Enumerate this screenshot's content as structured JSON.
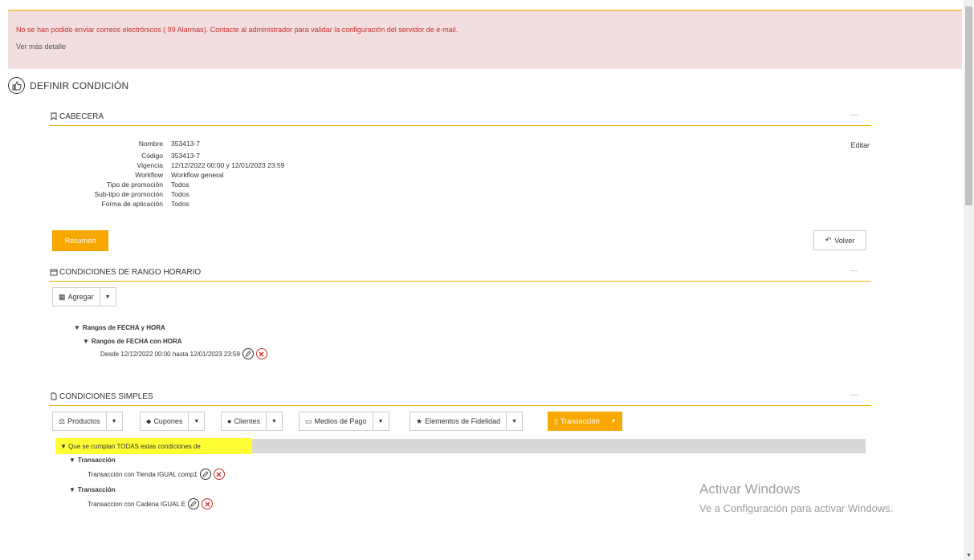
{
  "alert": {
    "message": "No se han podido enviar correos electrónicos ( 99 Alarmas). Contacte al administrador para validar la configuración del servidor de e-mail.",
    "link": "Ver más detalle"
  },
  "page": {
    "title": "DEFINIR CONDICIÓN",
    "title_icon": "thumbs-up-icon"
  },
  "cabecera": {
    "title": "CABECERA",
    "collapse": "—",
    "edit_label": "Editar",
    "fields": [
      {
        "label": "Nombre",
        "value": "353413-7"
      },
      {
        "label": "Código",
        "value": "353413-7"
      },
      {
        "label": "Vigencia",
        "value": "12/12/2022 00:00 y 12/01/2023 23:59"
      },
      {
        "label": "Workflow",
        "value": "Workflow general"
      },
      {
        "label": "Tipo de promoción",
        "value": "Todos"
      },
      {
        "label": "Sub-tipo de promoción",
        "value": "Todos"
      },
      {
        "label": "Forma de aplicación",
        "value": "Todos"
      }
    ],
    "resumen_label": "Resumen",
    "volver_label": "Volver"
  },
  "rango": {
    "title": "CONDICIONES DE RANGO HORARIO",
    "collapse": "—",
    "agregar_label": "Agregar",
    "tree_root": "Rangos de FECHA y HORA",
    "tree_child": "Rangos de FECHA con HORA",
    "tree_item": "Desde 12/12/2022 00:00 hasta 12/01/2023 23:59"
  },
  "simples": {
    "title": "CONDICIONES SIMPLES",
    "collapse": "—",
    "buttons": [
      {
        "label": "Productos",
        "icon": "balance-scale-icon"
      },
      {
        "label": "Cupones",
        "icon": "tag-icon"
      },
      {
        "label": "Clientes",
        "icon": "user-icon"
      },
      {
        "label": "Medios de Pago",
        "icon": "credit-card-icon"
      },
      {
        "label": "Elementos de Fidelidad",
        "icon": "star-icon"
      },
      {
        "label": "Transacción",
        "icon": "file-icon"
      }
    ],
    "all_conditions": "Que se cumplan TODAS estas condiciones de",
    "groups": [
      {
        "title": "Transacción",
        "item": "Transacción con Tienda IGUAL comp1"
      },
      {
        "title": "Transacción",
        "item": "Transaccion con Cadena IGUAL E"
      }
    ]
  },
  "watermark": {
    "line1": "Activar Windows",
    "line2": "Ve a Configuración para activar Windows."
  },
  "colors": {
    "accent": "#f9a800",
    "alert_bg": "#f2dede",
    "alert_text": "#c9302c",
    "highlight": "#ffff33"
  }
}
